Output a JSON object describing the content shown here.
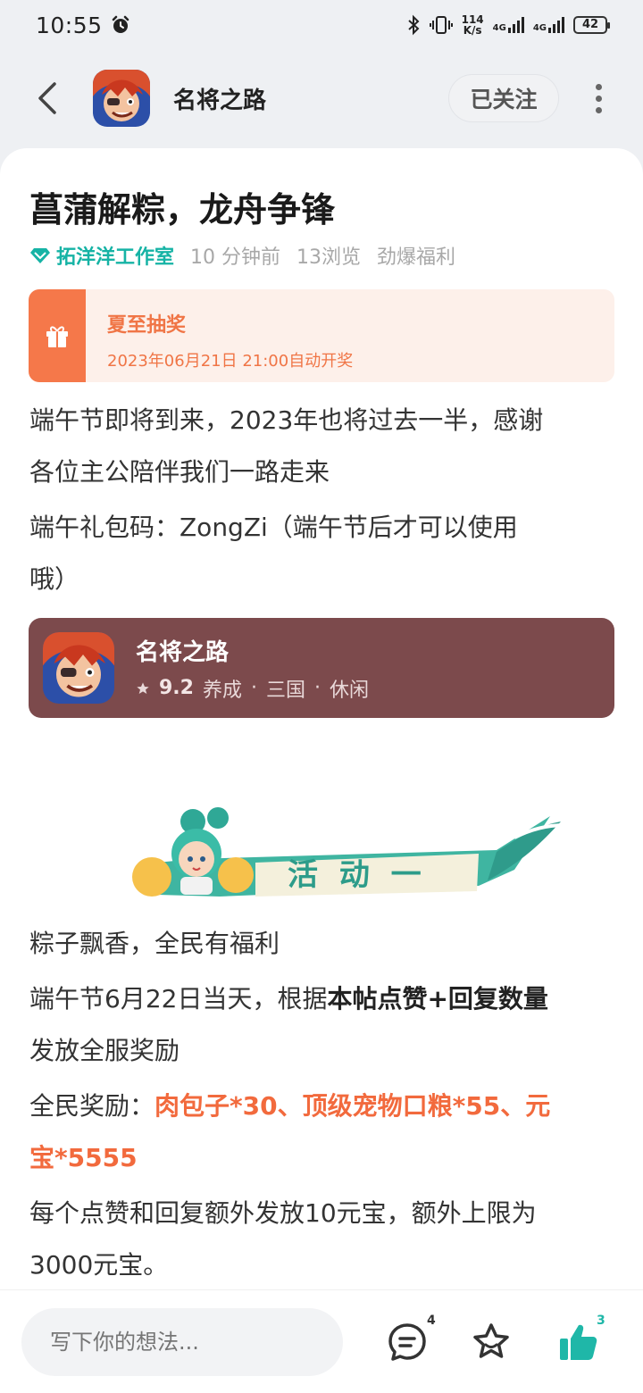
{
  "status": {
    "time": "10:55",
    "speed_value": "114",
    "speed_unit": "K/s",
    "net1": "4G",
    "net2": "4G",
    "battery": "42"
  },
  "header": {
    "title": "名将之路",
    "follow_label": "已关注"
  },
  "post": {
    "title": "菖蒲解粽，龙舟争锋",
    "author": "拓洋洋工作室",
    "time_ago": "10 分钟前",
    "views": "13浏览",
    "tag": "劲爆福利",
    "lottery": {
      "title": "夏至抽奖",
      "detail": "2023年06月21日 21:00自动开奖"
    },
    "intro_line1": "端午节即将到来，2023年也将过去一半，感谢",
    "intro_line2": "各位主公陪伴我们一路走来",
    "code_line1": "端午礼包码：ZongZi（端午节后才可以使用",
    "code_line2": "哦）",
    "game": {
      "name": "名将之路",
      "rating": "9.2",
      "tags": [
        "养成",
        "三国",
        "休闲"
      ]
    },
    "banner_text": "活 动 一",
    "section_title": "粽子飘香，全民有福利",
    "rule_prefix": "端午节6月22日当天，根据",
    "rule_strong": "本帖点赞+回复数量",
    "rule_suffix": "发放全服奖励",
    "reward_label": "全民奖励：",
    "reward_line1": "肉包子*30、顶级宠物口粮*55、元",
    "reward_line2": "宝*5555",
    "extra_line1": "每个点赞和回复额外发放10元宝，额外上限为",
    "extra_line2": "3000元宝。"
  },
  "bottom": {
    "placeholder": "写下你的想法...",
    "comment_count": "4",
    "like_count": "3"
  },
  "colors": {
    "accent": "#16b3a5",
    "orange": "#f26a3d",
    "game_card": "#7c4a4c",
    "like": "#1fb7a8"
  }
}
